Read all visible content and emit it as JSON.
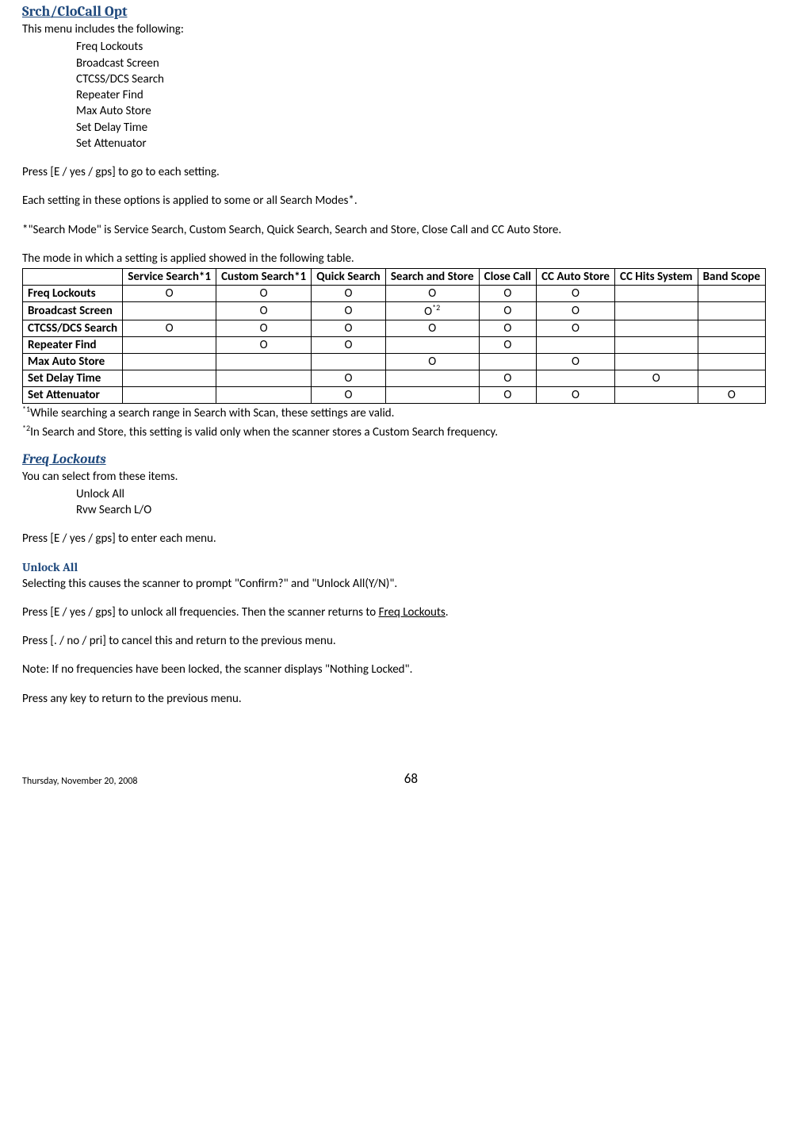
{
  "h1": "Srch/CloCall Opt",
  "intro_line": "This menu includes the following:",
  "menu_items": [
    "Freq Lockouts",
    "Broadcast Screen",
    "CTCSS/DCS Search",
    "Repeater Find",
    "Max Auto Store",
    "Set Delay Time",
    "Set Attenuator"
  ],
  "press_para1": "Press [E / yes / gps] to go to each setting.",
  "applied_para": "Each setting in these options is applied to some or all Search Modes*.",
  "search_mode_para": "*\"Search Mode\" is Service Search, Custom Search, Quick Search, Search and Store, Close Call and CC Auto Store.",
  "table_intro": "The mode in which a setting is applied showed in the following table.",
  "table": {
    "headers": [
      "",
      "Service Search*1",
      "Custom Search*1",
      "Quick Search",
      "Search and Store",
      "Close Call",
      "CC Auto Store",
      "CC Hits System",
      "Band Scope"
    ],
    "rows": [
      {
        "label": "Freq Lockouts",
        "cells": [
          "O",
          "O",
          "O",
          "O",
          "O",
          "O",
          "",
          ""
        ]
      },
      {
        "label": "Broadcast Screen",
        "cells": [
          "",
          "O",
          "O",
          "O_sup2",
          "O",
          "O",
          "",
          ""
        ]
      },
      {
        "label": "CTCSS/DCS Search",
        "cells": [
          "O",
          "O",
          "O",
          "O",
          "O",
          "O",
          "",
          ""
        ]
      },
      {
        "label": "Repeater Find",
        "cells": [
          "",
          "O",
          "O",
          "",
          "O",
          "",
          "",
          ""
        ]
      },
      {
        "label": "Max Auto Store",
        "cells": [
          "",
          "",
          "",
          "O",
          "",
          "O",
          "",
          ""
        ]
      },
      {
        "label": "Set Delay Time",
        "cells": [
          "",
          "",
          "O",
          "",
          "O",
          "",
          "O",
          ""
        ]
      },
      {
        "label": "Set Attenuator",
        "cells": [
          "",
          "",
          "O",
          "",
          "O",
          "O",
          "",
          "O"
        ]
      }
    ]
  },
  "footnote1_sup": "*1",
  "footnote1_text": "While searching a search range in Search with Scan, these settings are valid.",
  "footnote2_sup": "*2",
  "footnote2_text": "In Search and Store, this setting is valid only when the scanner stores a Custom Search frequency.",
  "h2_freq": "Freq Lockouts",
  "freq_intro": "You can select from these items.",
  "freq_items": [
    "Unlock All",
    "Rvw Search L/O"
  ],
  "freq_press": "Press [E / yes / gps] to enter each menu.",
  "h3_unlock": "Unlock All",
  "unlock_p1": "Selecting this causes the scanner to prompt \"Confirm?\" and \"Unlock All(Y/N)\".",
  "unlock_p2_a": "Press [E / yes / gps] to unlock all frequencies. Then the scanner returns to ",
  "unlock_p2_link": "Freq Lockouts",
  "unlock_p2_b": ".",
  "unlock_p3": "Press [. / no / pri] to cancel this and return to the previous menu.",
  "unlock_p4": "Note: If no frequencies have been locked, the scanner displays \"Nothing Locked\".",
  "unlock_p5": "Press any key to return to the previous menu.",
  "footer_date": "Thursday, November 20, 2008",
  "footer_page": "68"
}
